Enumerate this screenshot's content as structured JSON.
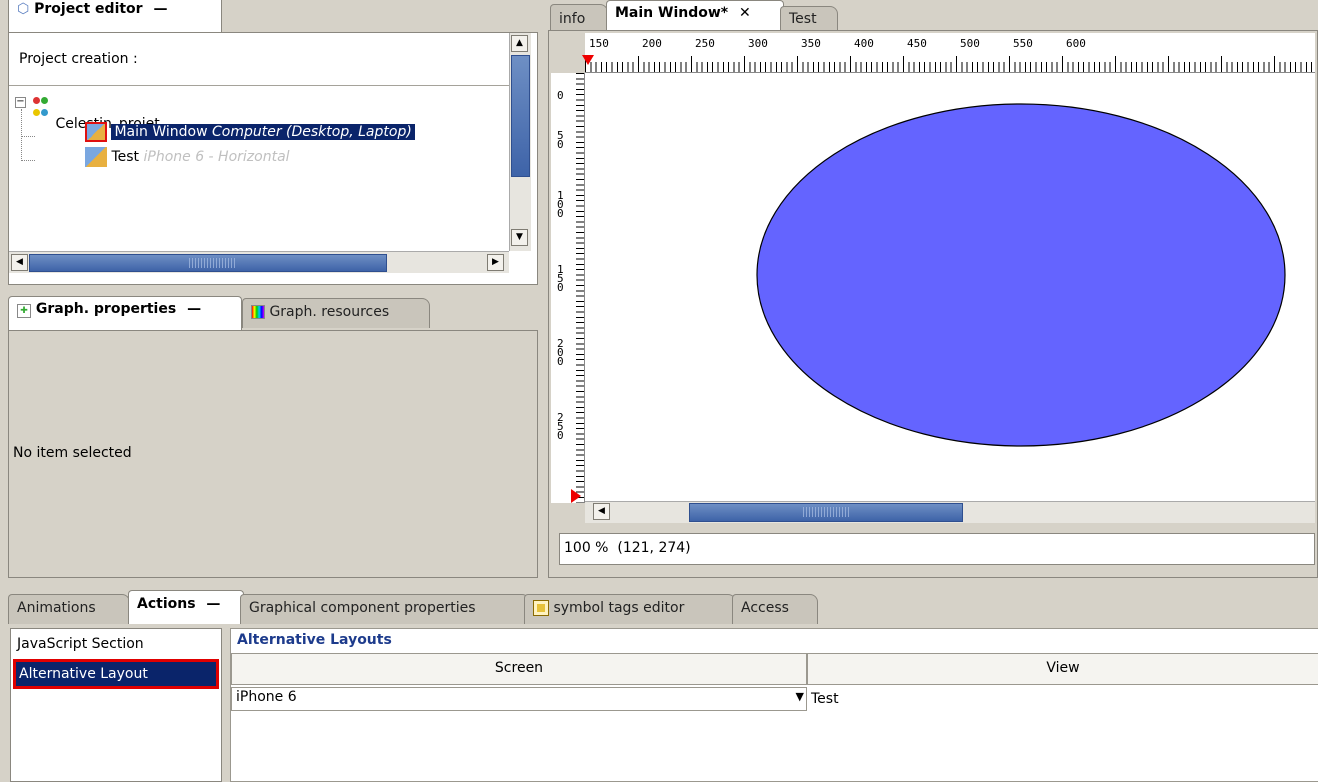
{
  "project_editor": {
    "tab_label": "Project editor",
    "minimize": "—",
    "heading": "Project creation :",
    "tree": {
      "root": "Celestin_projet",
      "items": [
        {
          "name": "Main Window",
          "device": "Computer (Desktop, Laptop)",
          "selected": true
        },
        {
          "name": "Test",
          "device": "iPhone 6 - Horizontal",
          "selected": false
        }
      ]
    }
  },
  "graph_panel": {
    "tabs": [
      {
        "label": "Graph. properties",
        "active": true
      },
      {
        "label": "Graph. resources",
        "active": false
      }
    ],
    "minimize": "—",
    "empty_text": "No item selected"
  },
  "editor": {
    "tabs": [
      {
        "label": "info",
        "active": false
      },
      {
        "label": "Main Window*",
        "active": true
      },
      {
        "label": "Test",
        "active": false
      }
    ],
    "close_glyph": "✕",
    "ruler_h_labels": [
      "150",
      "200",
      "250",
      "300",
      "350",
      "400",
      "450",
      "500",
      "550",
      "600"
    ],
    "ruler_v_labels": [
      "0",
      "5\n0",
      "1\n0\n0",
      "1\n5\n0",
      "2\n0\n0",
      "2\n5\n0"
    ],
    "shape": {
      "type": "ellipse",
      "fill": "#6464ff",
      "stroke": "#000000"
    },
    "status": "100 %  (121, 274)"
  },
  "bottom": {
    "tabs": [
      {
        "label": "Animations",
        "active": false
      },
      {
        "label": "Actions",
        "active": true
      },
      {
        "label": "Graphical component properties",
        "active": false
      },
      {
        "label": "symbol tags editor",
        "active": false
      },
      {
        "label": "Access",
        "active": false
      }
    ],
    "minimize": "—",
    "sections": [
      {
        "label": "JavaScript Section",
        "selected": false
      },
      {
        "label": "Alternative Layout",
        "selected": true
      }
    ],
    "group_title": "Alternative Layouts",
    "columns": [
      "Screen",
      "View"
    ],
    "rows": [
      {
        "screen": "iPhone 6",
        "view": "Test"
      }
    ]
  },
  "colors": {
    "selection": "#0a246a",
    "highlight_box": "#e00000",
    "ellipse": "#6464ff"
  }
}
